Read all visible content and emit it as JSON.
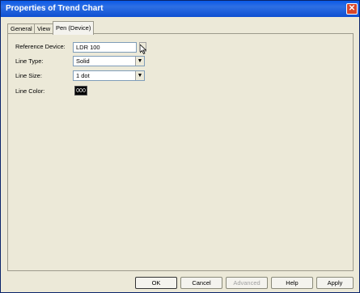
{
  "window": {
    "title": "Properties of Trend Chart",
    "close_glyph": "✕"
  },
  "tabs": [
    {
      "label": "General"
    },
    {
      "label": "View"
    },
    {
      "label": "Pen (Device)"
    }
  ],
  "form": {
    "reference_device": {
      "label": "Reference Device:",
      "value": "LDR 100"
    },
    "line_type": {
      "label": "Line Type:",
      "value": "Solid"
    },
    "line_size": {
      "label": "Line Size:",
      "value": "1 dot"
    },
    "line_color": {
      "label": "Line Color:",
      "value": "000",
      "color": "#000000"
    }
  },
  "buttons": {
    "ok": "OK",
    "cancel": "Cancel",
    "advanced": "Advanced",
    "help": "Help",
    "apply": "Apply"
  },
  "icons": {
    "dropdown": "chevron-down-icon",
    "close": "close-icon"
  }
}
